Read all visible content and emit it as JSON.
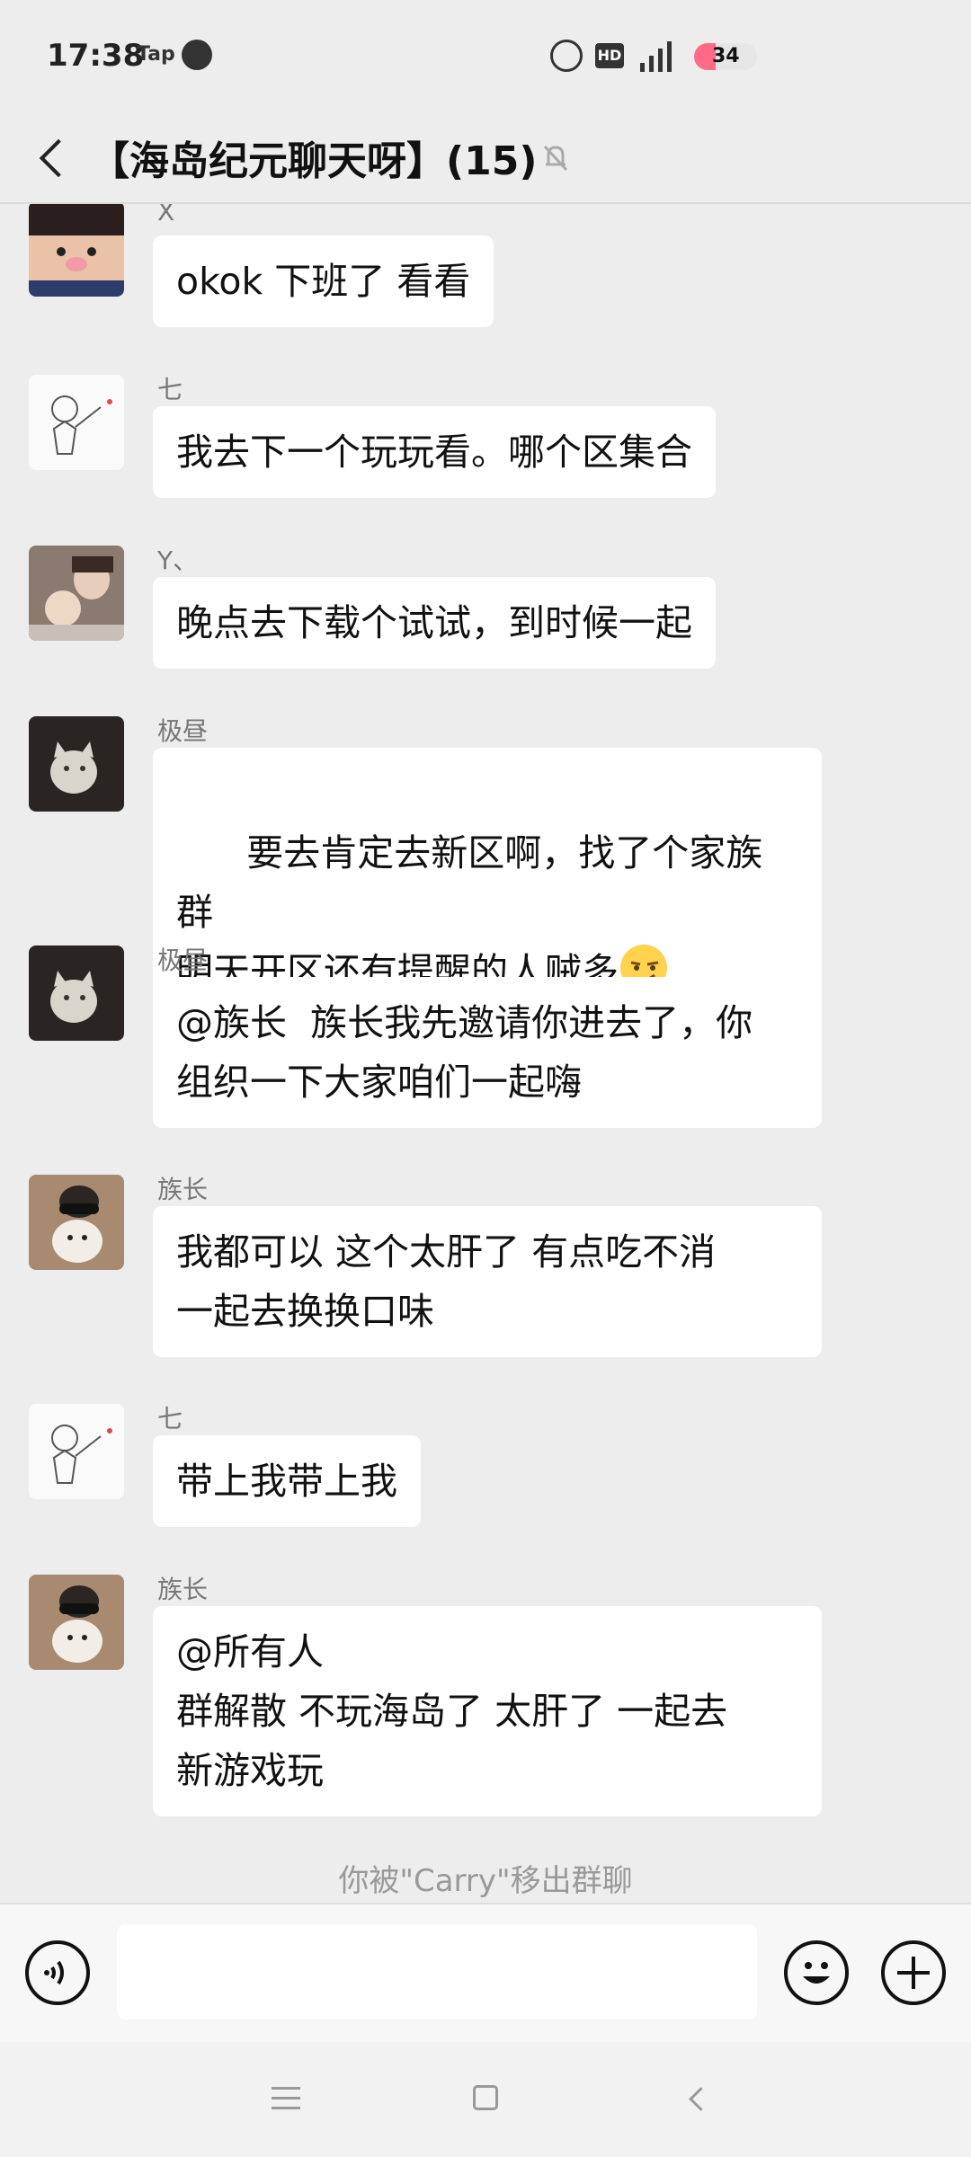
{
  "status_bar": {
    "time": "17:38",
    "app_badge": "Tap",
    "hd_badge": "HD",
    "network": "4G",
    "battery_level": "34",
    "battery_color": "#ff6b86"
  },
  "header": {
    "title": "【海岛纪元聊天呀】(15)",
    "back_icon": "chevron-left-icon",
    "mute_icon": "bell-muted-icon"
  },
  "messages": [
    {
      "sender": "X",
      "text": "okok 下班了 看看",
      "avatar": "pig-nose-kid-avatar"
    },
    {
      "sender": "七",
      "text": "我去下一个玩玩看。哪个区集合",
      "avatar": "sketch-boy-avatar"
    },
    {
      "sender": "Y、",
      "text": "晚点去下载个试试，到时候一起",
      "avatar": "mother-baby-avatar"
    },
    {
      "sender": "极昼",
      "text": "要去肯定去新区啊，找了个家族群\n明天开区还有提醒的人贼多",
      "emoji": "smirk-emoji",
      "avatar": "cat-avatar"
    },
    {
      "sender": "极昼",
      "text": "@族长  族长我先邀请你进去了，你\n组织一下大家咱们一起嗨",
      "avatar": "cat-avatar"
    },
    {
      "sender": "族长",
      "text": "我都可以 这个太肝了 有点吃不消\n一起去换换口味",
      "avatar": "dog-goggles-avatar"
    },
    {
      "sender": "七",
      "text": "带上我带上我",
      "avatar": "sketch-boy-avatar"
    },
    {
      "sender": "族长",
      "text": "@所有人\n群解散 不玩海岛了 太肝了 一起去\n新游戏玩",
      "avatar": "dog-goggles-avatar"
    }
  ],
  "system_notice": "你被\"Carry\"移出群聊",
  "input_bar": {
    "voice_icon": "voice-icon",
    "input_value": "",
    "emoji_icon": "smiley-face-icon",
    "more_icon": "plus-circle-icon"
  },
  "system_nav": {
    "menu_icon": "menu-icon",
    "home_icon": "home-square-icon",
    "back_icon": "back-triangle-icon"
  }
}
